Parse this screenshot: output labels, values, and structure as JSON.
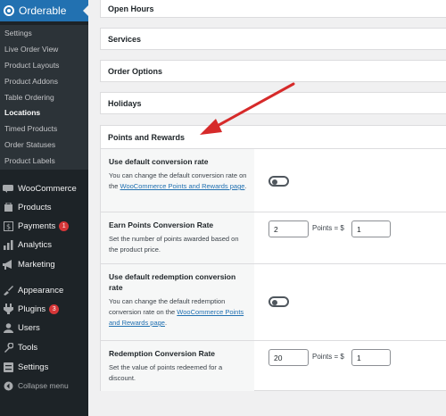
{
  "sidebar": {
    "brand": "Orderable",
    "submenu": [
      "Settings",
      "Live Order View",
      "Product Layouts",
      "Product Addons",
      "Table Ordering",
      "Locations",
      "Timed Products",
      "Order Statuses",
      "Product Labels"
    ],
    "active_submenu": "Locations",
    "menu": [
      {
        "label": "WooCommerce",
        "icon": "woocommerce-icon"
      },
      {
        "label": "Products",
        "icon": "products-icon"
      },
      {
        "label": "Payments",
        "icon": "payments-icon",
        "badge": "1"
      },
      {
        "label": "Analytics",
        "icon": "analytics-icon"
      },
      {
        "label": "Marketing",
        "icon": "marketing-icon"
      },
      {
        "label": "Appearance",
        "icon": "appearance-icon"
      },
      {
        "label": "Plugins",
        "icon": "plugins-icon",
        "badge": "3"
      },
      {
        "label": "Users",
        "icon": "users-icon"
      },
      {
        "label": "Tools",
        "icon": "tools-icon"
      },
      {
        "label": "Settings",
        "icon": "settings-icon"
      }
    ],
    "collapse": "Collapse menu"
  },
  "sections": [
    "Open Hours",
    "Services",
    "Order Options",
    "Holidays"
  ],
  "points_rewards": {
    "title": "Points and Rewards",
    "rows": [
      {
        "title": "Use default conversion rate",
        "desc_pre": "You can change the default conversion rate on the ",
        "link": "WooCommerce Points and Rewards page",
        "desc_post": ".",
        "control": "toggle",
        "enabled": false
      },
      {
        "title": "Earn Points Conversion Rate",
        "desc": "Set the number of points awarded based on the product price.",
        "points_value": "2",
        "points_label": "Points = $",
        "dollar_value": "1"
      },
      {
        "title": "Use default redemption conversion rate",
        "desc_pre": "You can change the default redemption conversion rate on the ",
        "link": "WooCommerce Points and Rewards page",
        "desc_post": ".",
        "control": "toggle",
        "enabled": false
      },
      {
        "title": "Redemption Conversion Rate",
        "desc": "Set the value of points redeemed for a discount.",
        "points_value": "20",
        "points_label": "Points = $",
        "dollar_value": "1"
      }
    ]
  },
  "colors": {
    "sidebar": "#1d2327",
    "accent": "#2271b1",
    "badge": "#d63638",
    "arrow": "#d62a2a"
  }
}
